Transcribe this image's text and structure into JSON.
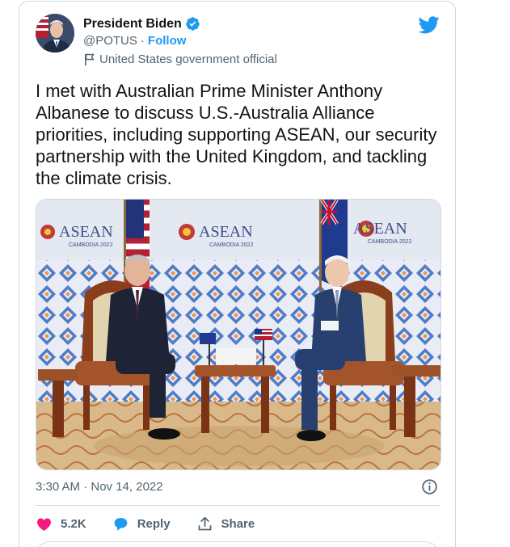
{
  "author": {
    "display_name": "President Biden",
    "handle": "@POTUS",
    "separator": "·",
    "follow_label": "Follow",
    "account_label": "United States government official"
  },
  "tweet": {
    "text": "I met with Australian Prime Minister Anthony Albanese to discuss U.S.-Australia Alliance priorities, including supporting ASEAN, our security partnership with the United Kingdom, and tackling the climate crisis.",
    "timestamp": "3:30 AM · Nov 14, 2022"
  },
  "media": {
    "banner_text": "ASEAN",
    "banner_subtext": "CAMBODIA 2022"
  },
  "actions": {
    "like_count": "5.2K",
    "reply_label": "Reply",
    "share_label": "Share"
  },
  "colors": {
    "accent": "#1d9bf0",
    "like": "#f91880",
    "text": "#0f1419",
    "secondary": "#536471",
    "border": "#cfd9de"
  },
  "icons": {
    "verified": "verified-badge-icon",
    "bird": "twitter-bird-icon",
    "flag": "flag-icon",
    "info": "info-icon",
    "like": "heart-icon",
    "reply": "reply-bubble-icon",
    "share": "share-icon"
  }
}
